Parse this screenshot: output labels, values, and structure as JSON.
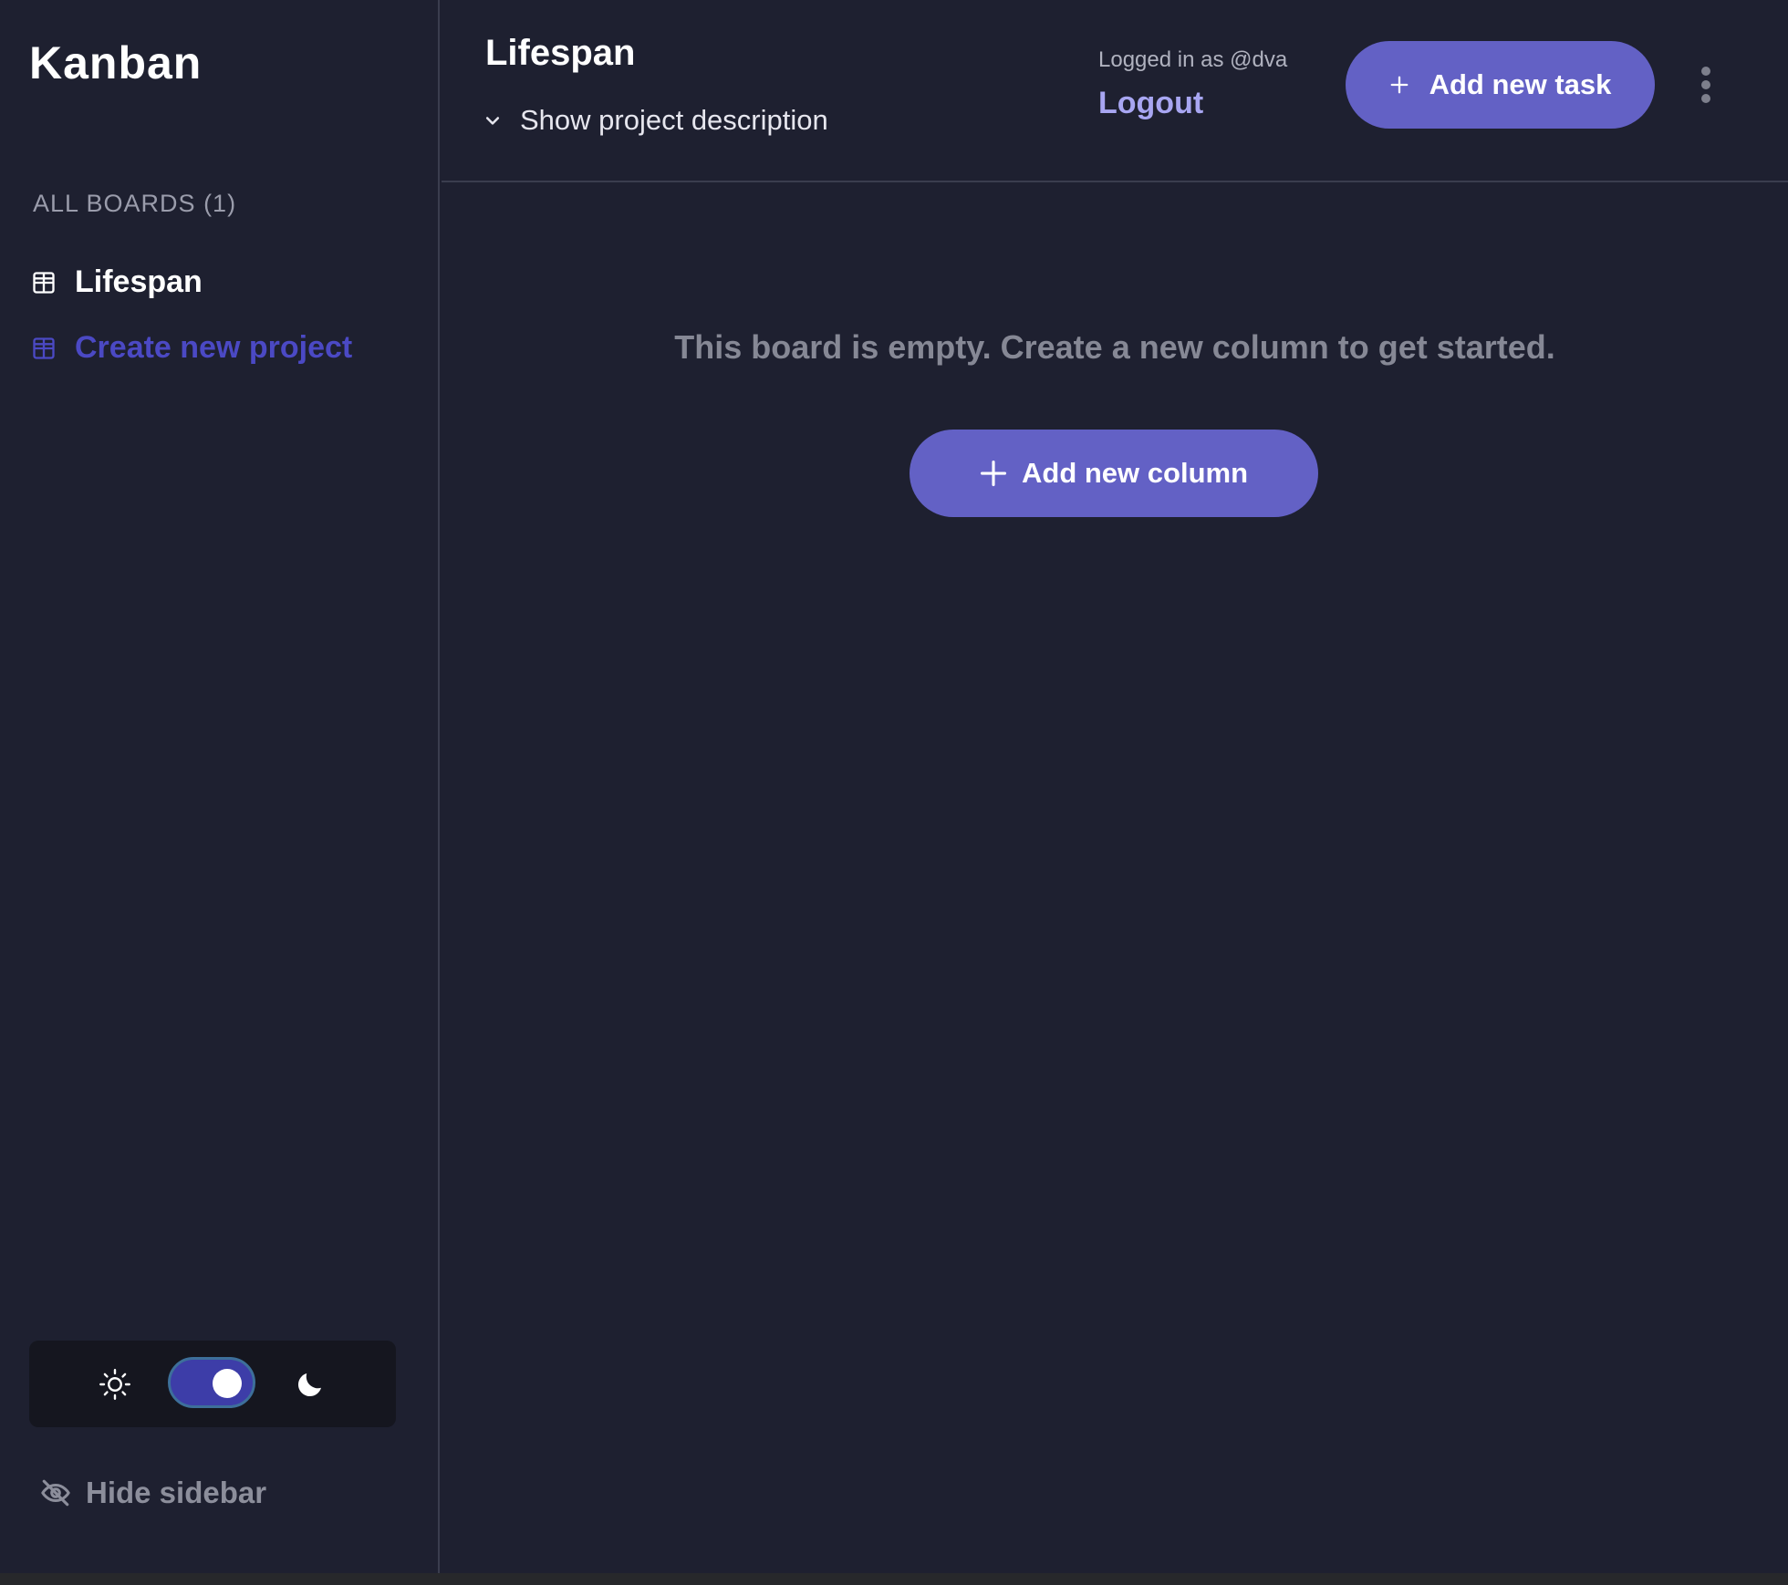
{
  "colors": {
    "background": "#1e2030",
    "accent": "#6361c5",
    "create_link": "#4b49c4",
    "logout_link": "#a8a6f2",
    "muted_text": "#868895"
  },
  "sidebar": {
    "logo": "Kanban",
    "boards_heading": "ALL BOARDS (1)",
    "boards": [
      {
        "label": "Lifespan",
        "icon": "board-grid-icon",
        "active": true
      }
    ],
    "create_project_label": "Create new project",
    "theme": {
      "mode": "dark",
      "light_icon": "sun-icon",
      "dark_icon": "moon-icon"
    },
    "hide_sidebar_label": "Hide sidebar",
    "hide_sidebar_icon": "eye-off-icon"
  },
  "header": {
    "project_title": "Lifespan",
    "description_toggle_label": "Show project description",
    "logged_in_text": "Logged in as @dva",
    "logout_label": "Logout",
    "add_task_label": "Add new task"
  },
  "board": {
    "empty_message": "This board is empty. Create a new column to get started.",
    "add_column_label": "Add new column"
  }
}
